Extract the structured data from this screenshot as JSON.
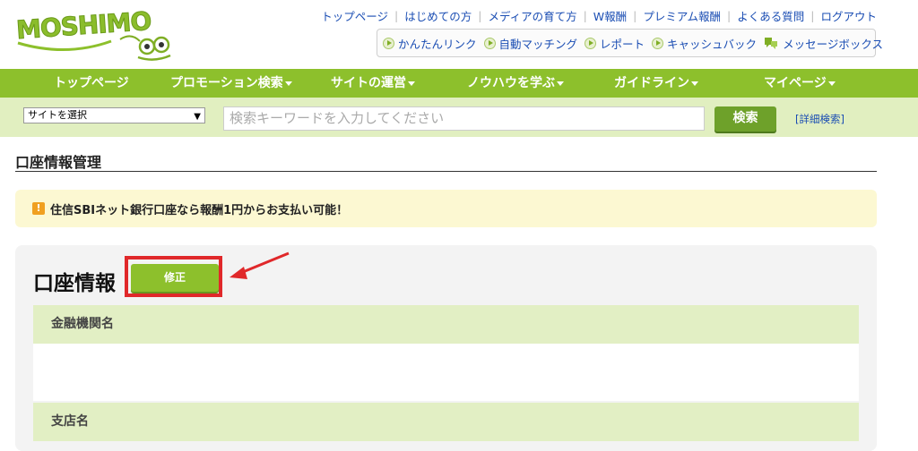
{
  "brand": {
    "logo_text": "MOSHIMO",
    "accent": "#8dc02c"
  },
  "top_links": [
    "トップページ",
    "はじめての方",
    "メディアの育て方",
    "W報酬",
    "プレミアム報酬",
    "よくある質問",
    "ログアウト"
  ],
  "sub_links": [
    "かんたんリンク",
    "自動マッチング",
    "レポート",
    "キャッシュバック"
  ],
  "message_box": "メッセージボックス",
  "nav": {
    "items": [
      "トップページ",
      "プロモーション検索",
      "サイトの運営",
      "ノウハウを学ぶ",
      "ガイドライン",
      "マイページ"
    ]
  },
  "search": {
    "site_select": "サイトを選択",
    "placeholder": "検索キーワードを入力してください",
    "button": "検索",
    "advanced": "[詳細検索]"
  },
  "page": {
    "title": "口座情報管理",
    "notice": "住信SBIネット銀行口座なら報酬1円からお支払い可能！",
    "section_title": "口座情報",
    "edit_button": "修正",
    "fields": [
      "金融機関名",
      "支店名"
    ]
  }
}
